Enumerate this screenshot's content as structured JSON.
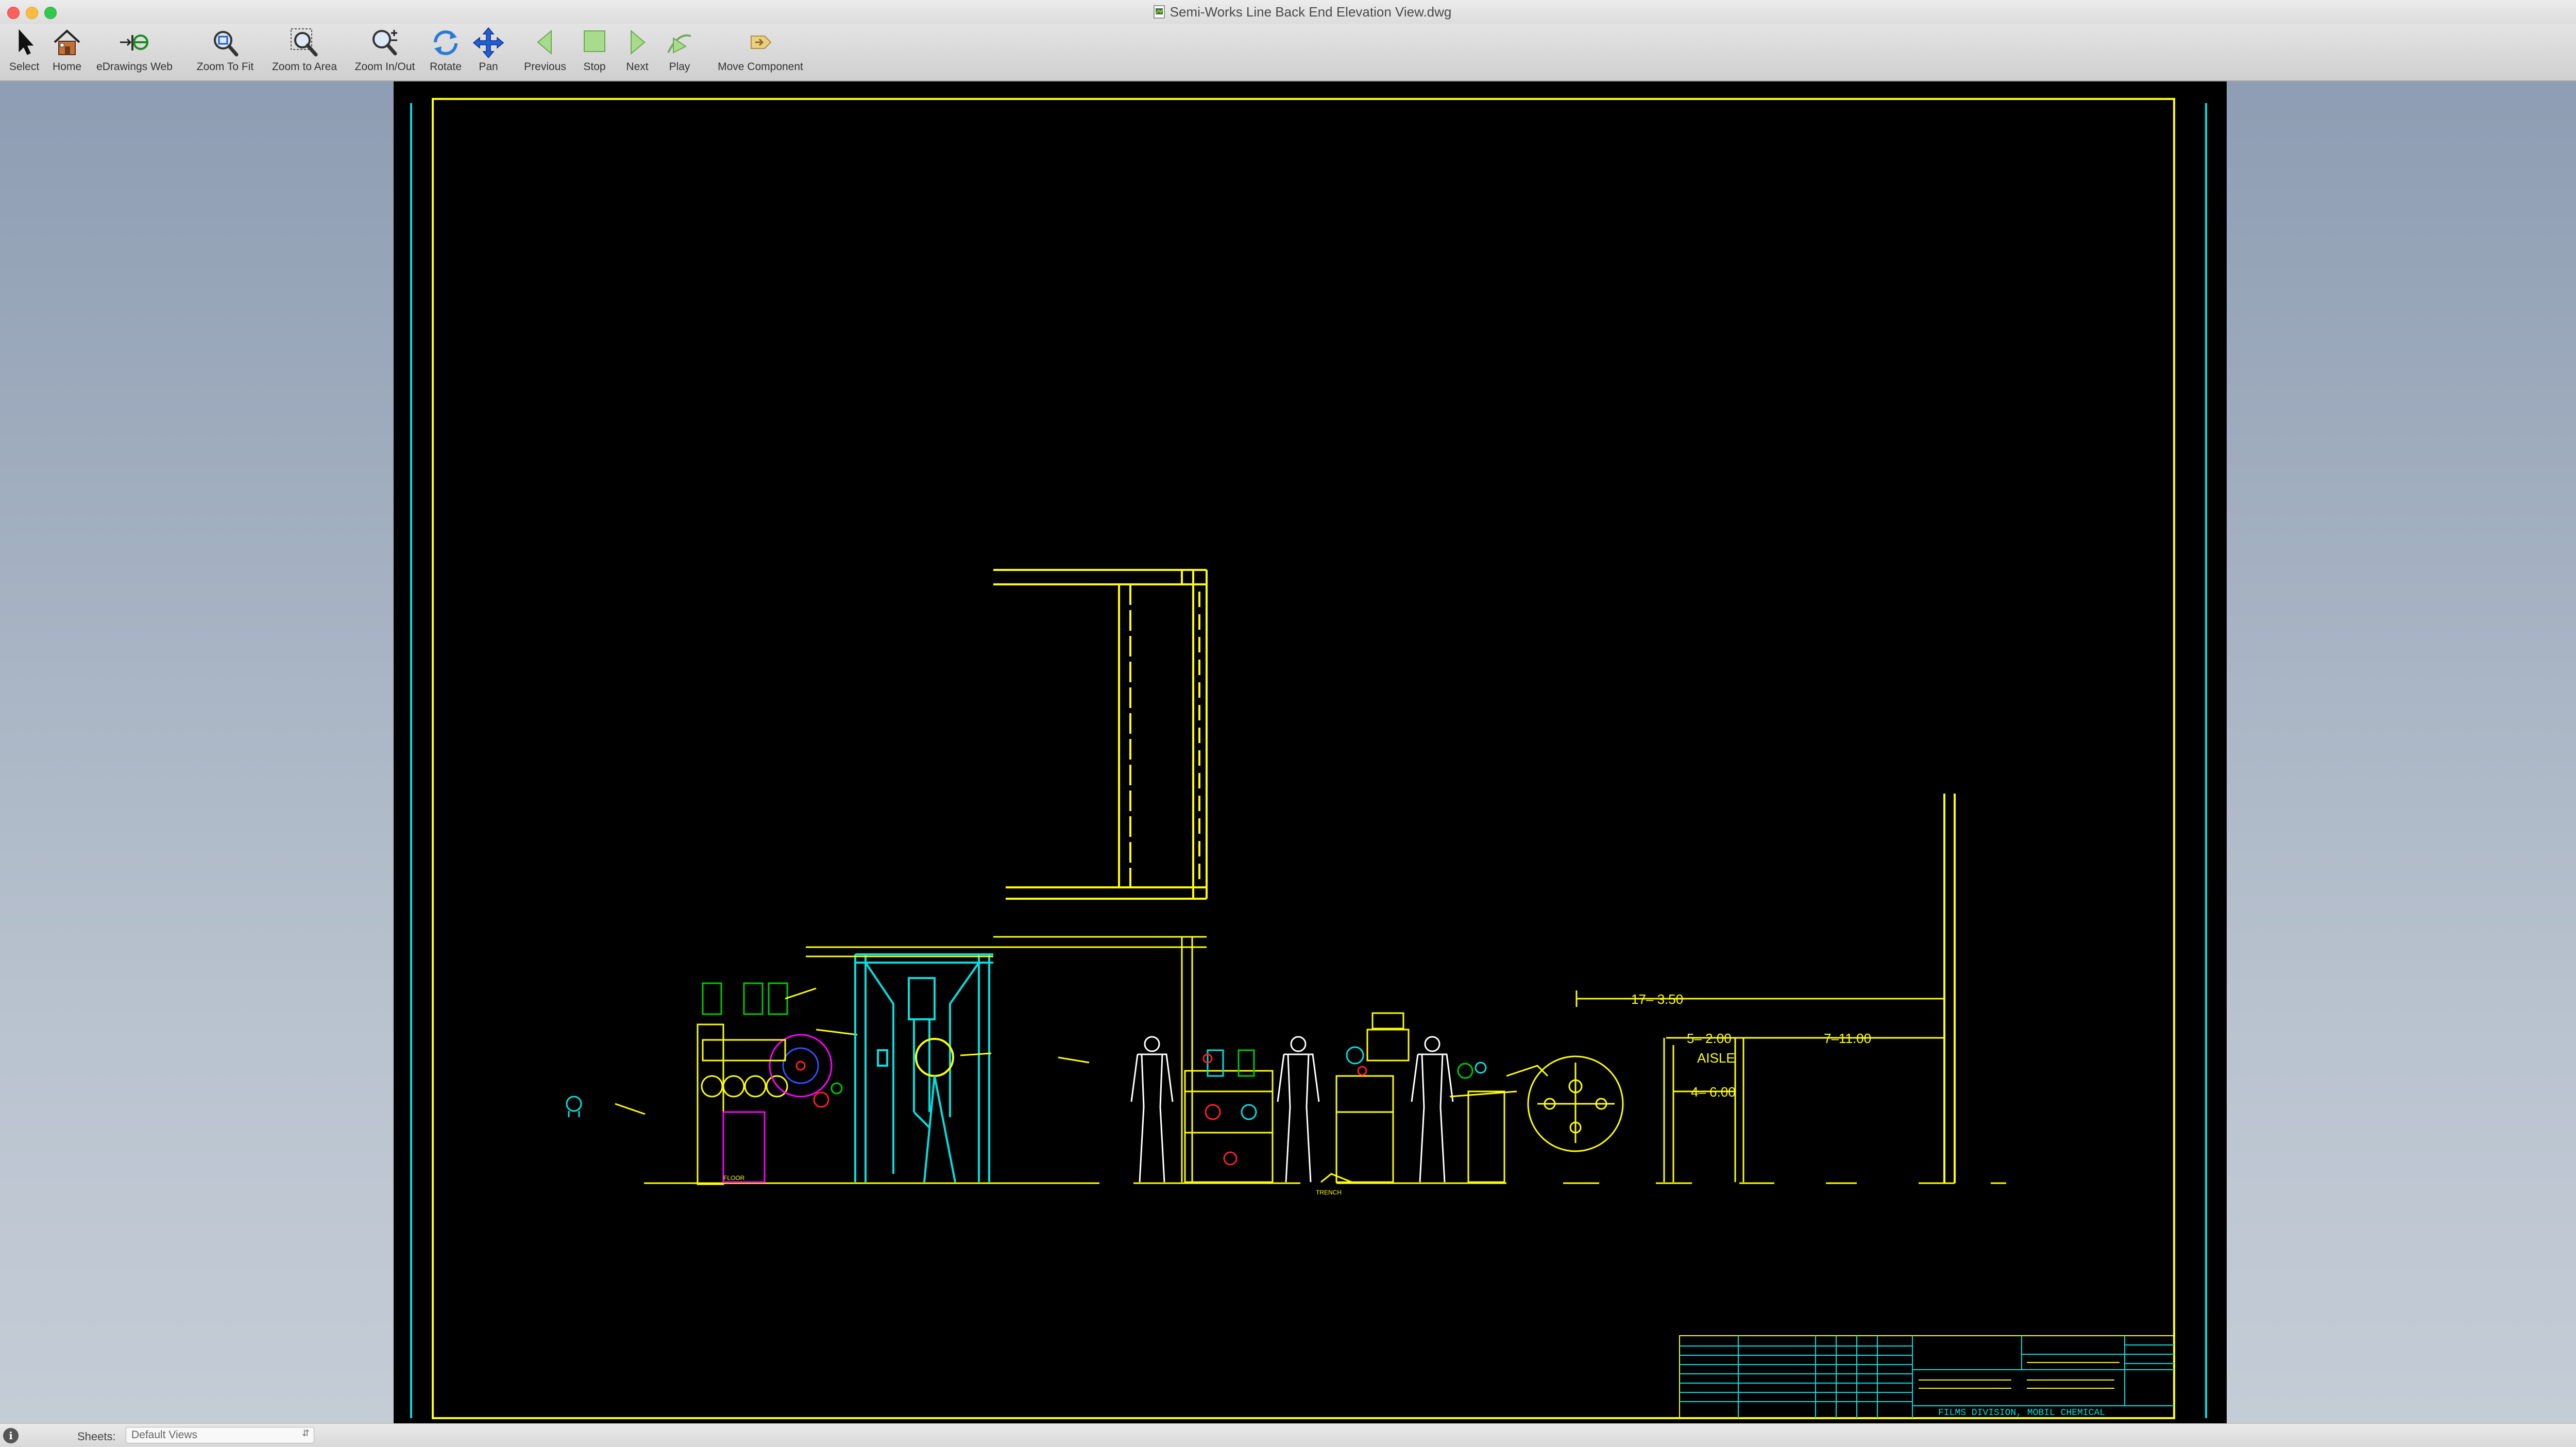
{
  "window": {
    "title": "Semi-Works Line Back End Elevation View.dwg"
  },
  "toolbar": {
    "items": [
      {
        "id": "select",
        "label": "Select",
        "icon": "arrow-pointer-icon"
      },
      {
        "id": "home",
        "label": "Home",
        "icon": "house-icon"
      },
      {
        "id": "edrawings-web",
        "label": "eDrawings Web",
        "icon": "edrawings-web-icon"
      },
      {
        "id": "zoom-to-fit",
        "label": "Zoom To Fit",
        "icon": "magnifier-fit-icon"
      },
      {
        "id": "zoom-to-area",
        "label": "Zoom to Area",
        "icon": "magnifier-area-icon"
      },
      {
        "id": "zoom-in-out",
        "label": "Zoom In/Out",
        "icon": "magnifier-plus-minus-icon"
      },
      {
        "id": "rotate",
        "label": "Rotate",
        "icon": "rotate-arrows-icon"
      },
      {
        "id": "pan",
        "label": "Pan",
        "icon": "four-way-arrows-icon"
      },
      {
        "id": "previous",
        "label": "Previous",
        "icon": "triangle-left-icon"
      },
      {
        "id": "stop",
        "label": "Stop",
        "icon": "square-stop-icon"
      },
      {
        "id": "next",
        "label": "Next",
        "icon": "triangle-right-icon"
      },
      {
        "id": "play",
        "label": "Play",
        "icon": "play-path-icon"
      },
      {
        "id": "move-component",
        "label": "Move Component",
        "icon": "move-component-icon"
      }
    ]
  },
  "drawing": {
    "dimensions": {
      "overall": "17– 3.50",
      "aisle_total": "5– 2.00",
      "aisle_label": "AISLE",
      "aisle_inner": "4– 6.00",
      "right_span": "7–11.00"
    },
    "labels": {
      "floor": "FLOOR",
      "trench": "TRENCH"
    },
    "title_block": {
      "company": "FILMS DIVISION, MOBIL CHEMICAL"
    }
  },
  "statusbar": {
    "sheets_label": "Sheets:",
    "sheets_value": "Default Views"
  },
  "colors": {
    "cad_yellow": "#ffff00",
    "cad_cyan": "#00e0e0",
    "cad_white": "#ffffff",
    "cad_green": "#00c800",
    "cad_red": "#ff2020",
    "cad_magenta": "#ff00ff",
    "cad_blue": "#3050ff"
  }
}
